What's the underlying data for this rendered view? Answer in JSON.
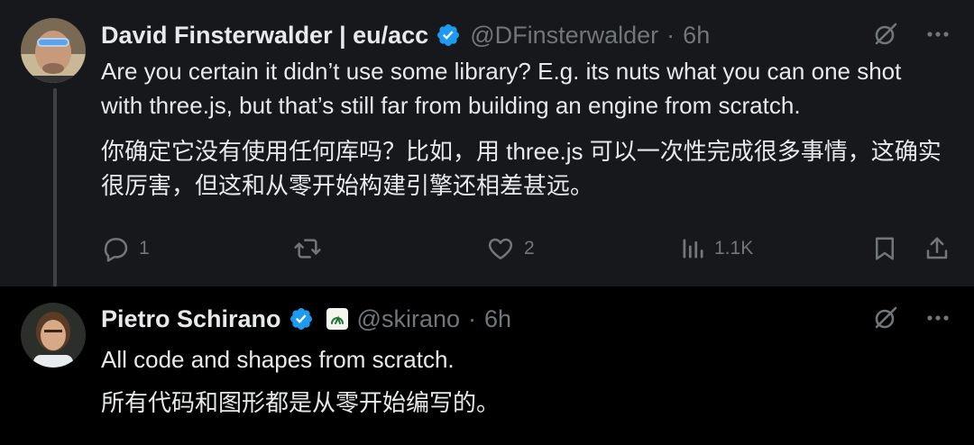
{
  "tweets": [
    {
      "author": "David Finsterwalder | eu/acc",
      "handle": "@DFinsterwalder",
      "separator": "·",
      "time": "6h",
      "text_en": "Are you certain it didn’t use some library? E.g. its nuts what you can one shot with three.js, but that’s still far from building an engine from scratch.",
      "text_zh": "你确定它没有使用任何库吗？比如，用 three.js 可以一次性完成很多事情，这确实很厉害，但这和从零开始构建引擎还相差甚远。",
      "actions": {
        "replies": "1",
        "retweets": "",
        "likes": "2",
        "views": "1.1K"
      }
    },
    {
      "author": "Pietro Schirano",
      "handle": "@skirano",
      "separator": "·",
      "time": "6h",
      "text_en": "All code and shapes from scratch.",
      "text_zh": "所有代码和图形都是从零开始编写的。"
    }
  ],
  "colors": {
    "verified": "#1d9bf0",
    "muted": "#71767b",
    "text": "#e7e9ea",
    "highlight_bg": "#16181c"
  },
  "icons": [
    "verified-badge-icon",
    "grok-icon",
    "more-icon",
    "reply-icon",
    "retweet-icon",
    "like-icon",
    "views-icon",
    "bookmark-icon",
    "share-icon",
    "affiliate-badge-icon"
  ]
}
